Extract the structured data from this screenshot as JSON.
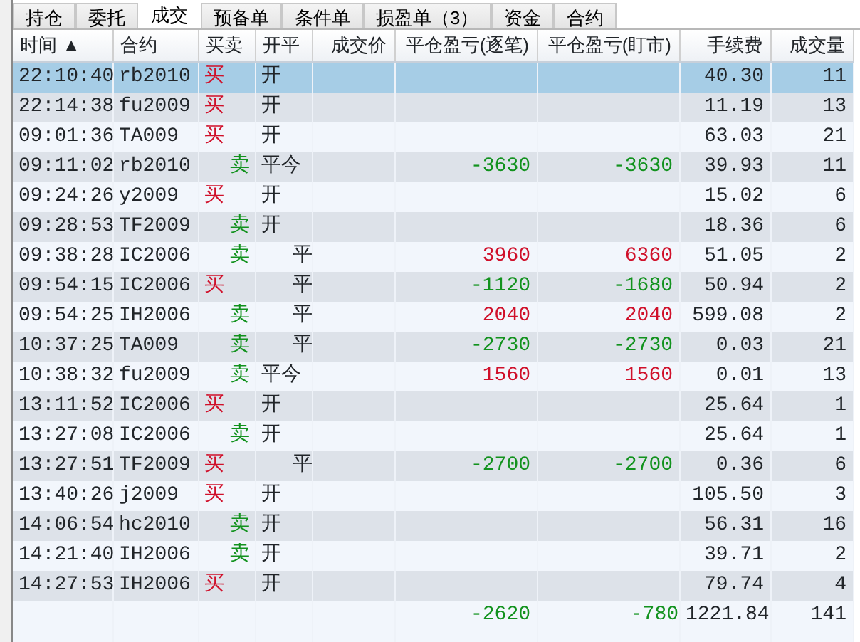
{
  "tabs": [
    {
      "label": "持仓",
      "selected": false
    },
    {
      "label": "委托",
      "selected": false
    },
    {
      "label": "成交",
      "selected": true
    },
    {
      "label": "预备单",
      "selected": false
    },
    {
      "label": "条件单",
      "selected": false
    },
    {
      "label": "损盈单（3）",
      "selected": false
    },
    {
      "label": "资金",
      "selected": false
    },
    {
      "label": "合约",
      "selected": false
    }
  ],
  "table": {
    "columns": [
      {
        "label": "时间",
        "sort_mark": "▲"
      },
      {
        "label": "合约"
      },
      {
        "label": "买卖"
      },
      {
        "label": "开平"
      },
      {
        "label": "成交价"
      },
      {
        "label": "平仓盈亏(逐笔)"
      },
      {
        "label": "平仓盈亏(盯市)"
      },
      {
        "label": "手续费"
      },
      {
        "label": "成交量"
      }
    ],
    "rows": [
      {
        "selected": true,
        "time": "22:10:40",
        "contract": "rb2010",
        "buy": true,
        "side_label": "买",
        "offset_indented": false,
        "offset": "开",
        "fee": "40.30",
        "volume": "11"
      },
      {
        "selected": false,
        "time": "22:14:38",
        "contract": "fu2009",
        "buy": true,
        "side_label": "买",
        "offset_indented": false,
        "offset": "开",
        "fee": "11.19",
        "volume": "13"
      },
      {
        "selected": false,
        "time": "09:01:36",
        "contract": "TA009",
        "buy": true,
        "side_label": "买",
        "offset_indented": false,
        "offset": "开",
        "fee": "63.03",
        "volume": "21"
      },
      {
        "selected": false,
        "time": "09:11:02",
        "contract": "rb2010",
        "buy": false,
        "side_label": "卖",
        "offset_indented": false,
        "offset": "平今",
        "profit": false,
        "pnl_trade": "-3630",
        "pnl_mark": "-3630",
        "fee": "39.93",
        "volume": "11"
      },
      {
        "selected": false,
        "time": "09:24:26",
        "contract": "y2009",
        "buy": true,
        "side_label": "买",
        "offset_indented": false,
        "offset": "开",
        "fee": "15.02",
        "volume": "6"
      },
      {
        "selected": false,
        "time": "09:28:53",
        "contract": "TF2009",
        "buy": false,
        "side_label": "卖",
        "offset_indented": false,
        "offset": "开",
        "fee": "18.36",
        "volume": "6"
      },
      {
        "selected": false,
        "time": "09:38:28",
        "contract": "IC2006",
        "buy": false,
        "side_label": "卖",
        "offset_indented": true,
        "offset": "平",
        "profit": true,
        "pnl_trade": "3960",
        "pnl_mark": "6360",
        "fee": "51.05",
        "volume": "2"
      },
      {
        "selected": false,
        "time": "09:54:15",
        "contract": "IC2006",
        "buy": true,
        "side_label": "买",
        "offset_indented": true,
        "offset": "平",
        "profit": false,
        "pnl_trade": "-1120",
        "pnl_mark": "-1680",
        "fee": "50.94",
        "volume": "2"
      },
      {
        "selected": false,
        "time": "09:54:25",
        "contract": "IH2006",
        "buy": false,
        "side_label": "卖",
        "offset_indented": true,
        "offset": "平",
        "profit": true,
        "pnl_trade": "2040",
        "pnl_mark": "2040",
        "fee": "599.08",
        "volume": "2"
      },
      {
        "selected": false,
        "time": "10:37:25",
        "contract": "TA009",
        "buy": false,
        "side_label": "卖",
        "offset_indented": true,
        "offset": "平",
        "profit": false,
        "pnl_trade": "-2730",
        "pnl_mark": "-2730",
        "fee": "0.03",
        "volume": "21"
      },
      {
        "selected": false,
        "time": "10:38:32",
        "contract": "fu2009",
        "buy": false,
        "side_label": "卖",
        "offset_indented": false,
        "offset": "平今",
        "profit": true,
        "pnl_trade": "1560",
        "pnl_mark": "1560",
        "fee": "0.01",
        "volume": "13"
      },
      {
        "selected": false,
        "time": "13:11:52",
        "contract": "IC2006",
        "buy": true,
        "side_label": "买",
        "offset_indented": false,
        "offset": "开",
        "fee": "25.64",
        "volume": "1"
      },
      {
        "selected": false,
        "time": "13:27:08",
        "contract": "IC2006",
        "buy": false,
        "side_label": "卖",
        "offset_indented": false,
        "offset": "开",
        "fee": "25.64",
        "volume": "1"
      },
      {
        "selected": false,
        "time": "13:27:51",
        "contract": "TF2009",
        "buy": true,
        "side_label": "买",
        "offset_indented": true,
        "offset": "平",
        "profit": false,
        "pnl_trade": "-2700",
        "pnl_mark": "-2700",
        "fee": "0.36",
        "volume": "6"
      },
      {
        "selected": false,
        "time": "13:40:26",
        "contract": "j2009",
        "buy": true,
        "side_label": "买",
        "offset_indented": false,
        "offset": "开",
        "fee": "105.50",
        "volume": "3"
      },
      {
        "selected": false,
        "time": "14:06:54",
        "contract": "hc2010",
        "buy": false,
        "side_label": "卖",
        "offset_indented": false,
        "offset": "开",
        "fee": "56.31",
        "volume": "16"
      },
      {
        "selected": false,
        "time": "14:21:40",
        "contract": "IH2006",
        "buy": false,
        "side_label": "卖",
        "offset_indented": false,
        "offset": "开",
        "fee": "39.71",
        "volume": "2"
      },
      {
        "selected": false,
        "time": "14:27:53",
        "contract": "IH2006",
        "buy": true,
        "side_label": "买",
        "offset_indented": false,
        "offset": "开",
        "fee": "79.74",
        "volume": "4"
      }
    ],
    "totals": {
      "profit": false,
      "pnl_trade": "-2620",
      "pnl_mark": "-780",
      "fee": "1221.84",
      "volume": "141"
    }
  }
}
